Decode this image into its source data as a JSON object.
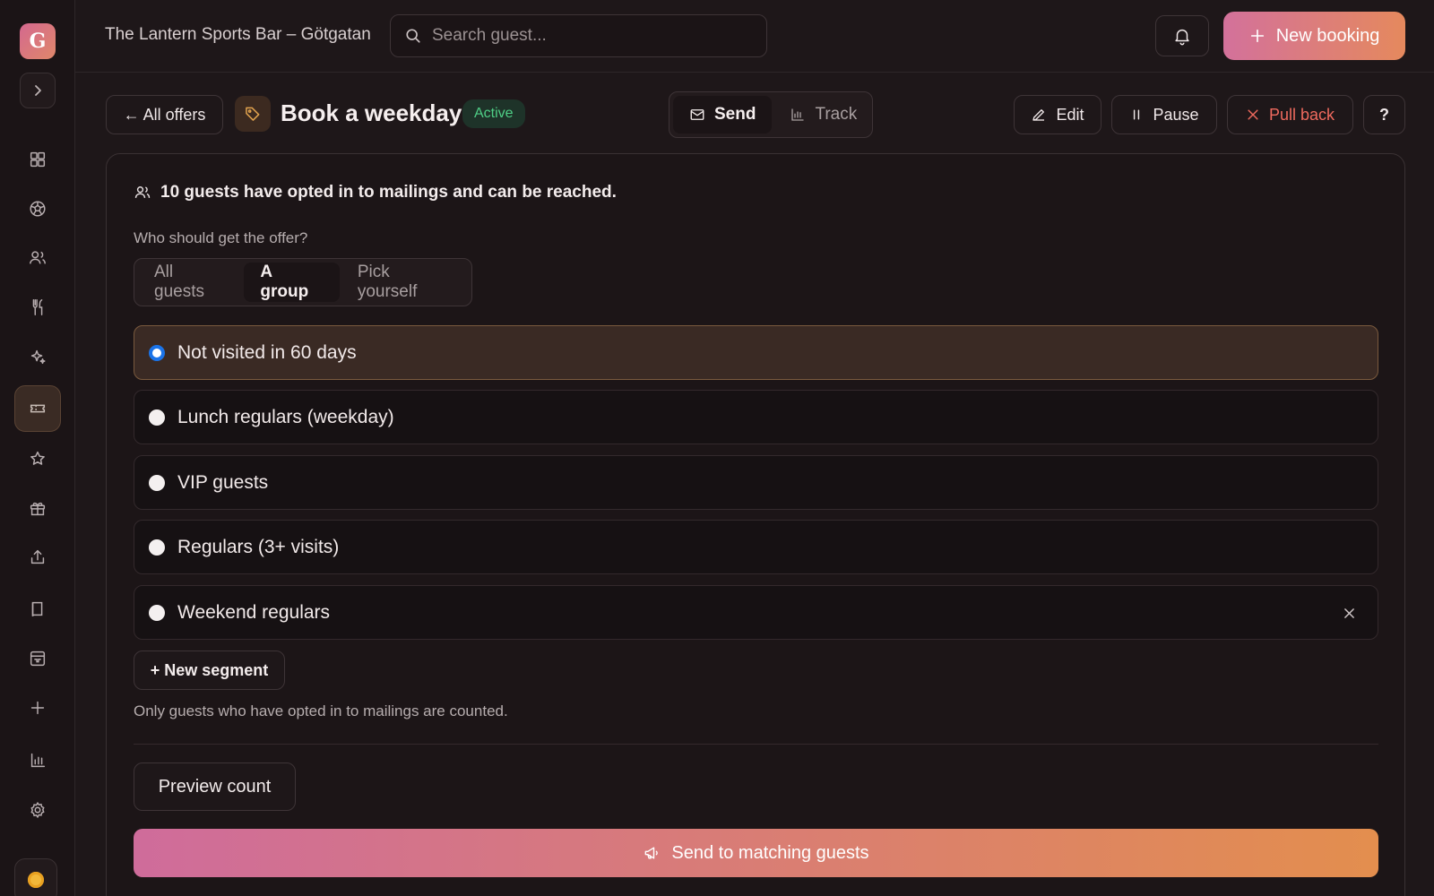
{
  "app": {
    "logo_letter": "G",
    "venue": "The Lantern Sports Bar – Götgatan",
    "accent_gradient": [
      "#d3719b",
      "#e5895d"
    ]
  },
  "search": {
    "placeholder": "Search guest..."
  },
  "header": {
    "new_booking_label": "New booking"
  },
  "sidebar": {
    "items": [
      {
        "icon": "dashboard-icon"
      },
      {
        "icon": "soccer-ball-icon"
      },
      {
        "icon": "guests-icon"
      },
      {
        "icon": "cutlery-icon"
      },
      {
        "icon": "sparkles-icon"
      },
      {
        "icon": "ticket-icon",
        "active": true
      },
      {
        "icon": "star-icon"
      },
      {
        "icon": "gift-icon"
      },
      {
        "icon": "share-icon"
      },
      {
        "icon": "book-icon"
      },
      {
        "icon": "inbox-icon"
      },
      {
        "icon": "plus-icon"
      },
      {
        "icon": "bar-chart-icon"
      },
      {
        "icon": "settings-icon"
      }
    ]
  },
  "offer": {
    "back_label": "← All offers",
    "title": "Book a weekday",
    "status": "Active",
    "status_color": "#4fcf86",
    "tabs": [
      {
        "label": "Send",
        "active": true
      },
      {
        "label": "Track",
        "active": false
      }
    ],
    "actions": {
      "edit": "Edit",
      "pause": "Pause",
      "pull_back": "Pull back",
      "help": "?"
    }
  },
  "panel": {
    "reach_text": "10 guests have opted in to mailings and can be reached.",
    "question": "Who should get the offer?",
    "audience_tabs": [
      {
        "label": "All guests",
        "active": false
      },
      {
        "label": "A group",
        "active": true
      },
      {
        "label": "Pick yourself",
        "active": false
      }
    ],
    "segments": [
      {
        "label": "Not visited in 60 days",
        "selected": true
      },
      {
        "label": "Lunch regulars (weekday)",
        "selected": false
      },
      {
        "label": "VIP guests",
        "selected": false
      },
      {
        "label": "Regulars (3+ visits)",
        "selected": false
      },
      {
        "label": "Weekend regulars",
        "selected": false,
        "removable": true
      }
    ],
    "new_segment_label": "+ New segment",
    "note": "Only guests who have opted in to mailings are counted.",
    "preview_label": "Preview count",
    "send_label": "Send to matching guests"
  }
}
